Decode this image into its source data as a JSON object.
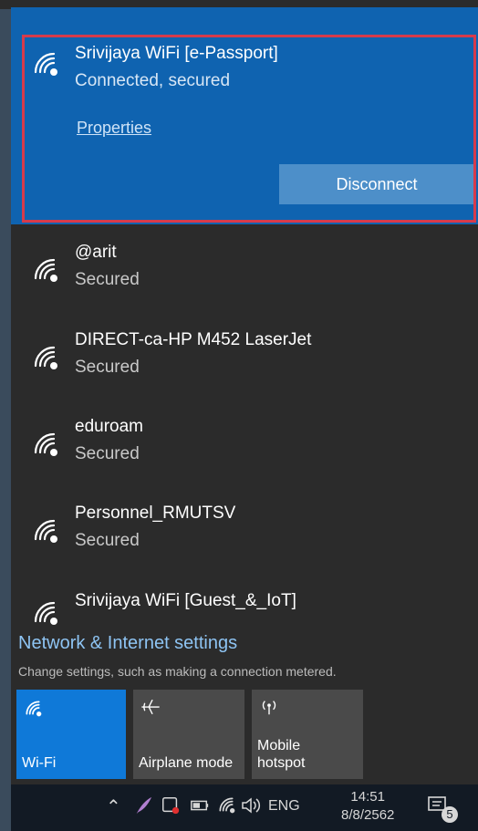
{
  "connected_network": {
    "name": "Srivijaya WiFi [e-Passport]",
    "status": "Connected, secured",
    "properties_label": "Properties",
    "disconnect_label": "Disconnect"
  },
  "networks": [
    {
      "name": "@arit",
      "status": "Secured"
    },
    {
      "name": "DIRECT-ca-HP M452 LaserJet",
      "status": "Secured"
    },
    {
      "name": "eduroam",
      "status": "Secured"
    },
    {
      "name": "Personnel_RMUTSV",
      "status": "Secured"
    },
    {
      "name": "Srivijaya WiFi [Guest_&_IoT]",
      "status": ""
    }
  ],
  "settings": {
    "link": "Network & Internet settings",
    "description": "Change settings, such as making a connection metered."
  },
  "quick_actions": {
    "wifi": "Wi-Fi",
    "airplane": "Airplane mode",
    "hotspot_line1": "Mobile",
    "hotspot_line2": "hotspot"
  },
  "taskbar": {
    "language": "ENG",
    "time": "14:51",
    "date": "8/8/2562",
    "notification_count": "5"
  },
  "colors": {
    "accent": "#0f79d8",
    "connected_bg": "#0f63b0",
    "highlight_border": "#d63b4c",
    "panel_bg": "#2b2b2b"
  }
}
